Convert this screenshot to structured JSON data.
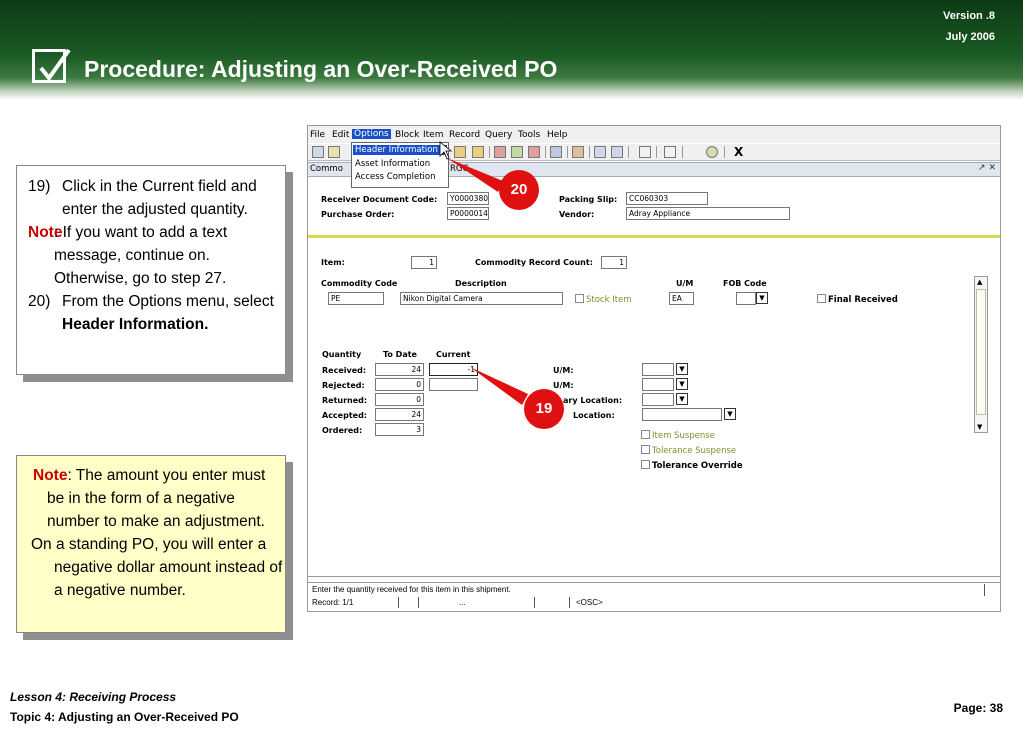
{
  "header": {
    "version": "Version .8",
    "date": "July  2006",
    "title": "Procedure:  Adjusting an Over-Received PO"
  },
  "instructions": {
    "step19_num": "19)",
    "step19_text": "Click in the Current field and enter the adjusted quantity.",
    "note_label": "Note",
    "note_text": ":  If you want to add a text message, continue on. Otherwise, go to step 27.",
    "step20_num": "20)",
    "step20_text": "From the Options menu, select ",
    "step20_bold": "Header Information."
  },
  "note_box": {
    "label": "Note",
    "text1": ": The amount you enter must be in the form of a negative number to make an adjustment.",
    "text2": "On a standing PO, you will enter a negative dollar amount instead of a negative number."
  },
  "app": {
    "menu": [
      "File",
      "Edit",
      "Options",
      "Block",
      "Item",
      "Record",
      "Query",
      "Tools",
      "Help"
    ],
    "window_title": "Commo",
    "window_title_tail": "RGC",
    "window_controls": "↗ ✕",
    "dropdown": [
      "Header Information",
      "Asset Information",
      "Access Completion"
    ],
    "toolbar_close": "X",
    "header_fields": {
      "receiver_label": "Receiver Document Code:",
      "receiver_value": "Y0000380",
      "po_label": "Purchase Order:",
      "po_value": "P0000014",
      "packing_label": "Packing Slip:",
      "packing_value": "CC060303",
      "vendor_label": "Vendor:",
      "vendor_value": "Adray Appliance"
    },
    "item_section": {
      "item_label": "Item:",
      "item_value": "1",
      "count_label": "Commodity Record Count:",
      "count_value": "1",
      "col_commodity": "Commodity Code",
      "col_description": "Description",
      "col_um": "U/M",
      "col_fob": "FOB Code",
      "commodity_value": "PE",
      "description_value": "Nikon Digital Camera",
      "stock_item": "Stock Item",
      "um_value": "EA",
      "final_received": "Final Received"
    },
    "qty_section": {
      "col_quantity": "Quantity",
      "col_todate": "To Date",
      "col_current": "Current",
      "received_label": "Received:",
      "received_todate": "24",
      "received_current": "-1",
      "rejected_label": "Rejected:",
      "rejected_todate": "0",
      "returned_label": "Returned:",
      "returned_todate": "0",
      "accepted_label": "Accepted:",
      "accepted_todate": "24",
      "ordered_label": "Ordered:",
      "ordered_todate": "3",
      "um1_label": "U/M:",
      "um2_label": "U/M:",
      "secondary_location": "ary Location:",
      "location": "Location:",
      "item_suspense": "Item  Suspense",
      "tolerance_suspense": "Tolerance Suspense",
      "tolerance_override": "Tolerance Override"
    },
    "status": {
      "message": "Enter the quantity received for this item in this shipment.",
      "record": "Record: 1/1",
      "dots": "...",
      "osc": "<OSC>"
    }
  },
  "callouts": {
    "c20": "20",
    "c19": "19"
  },
  "footer": {
    "lesson": "Lesson 4: Receiving Process",
    "topic": "Topic 4: Adjusting an Over-Received PO",
    "page": "Page: 38"
  }
}
